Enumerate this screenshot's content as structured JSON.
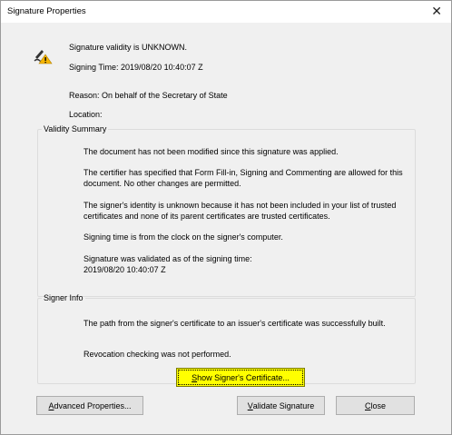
{
  "window": {
    "title": "Signature Properties",
    "close_glyph": "✕"
  },
  "signature": {
    "icon": "signature-warning-icon",
    "validity": "Signature validity is UNKNOWN.",
    "signing_time": "Signing Time:  2019/08/20 10:40:07 Z",
    "reason": "Reason:  On behalf of the Secretary of State",
    "location": "Location:"
  },
  "validity_summary": {
    "legend": "Validity Summary",
    "items": [
      "The document has not been modified since this signature was applied.",
      "The certifier has specified that Form Fill-in, Signing and Commenting are allowed for this document. No other changes are permitted.",
      "The signer's identity is unknown because it has not been included in your list of trusted certificates and none of its parent certificates are trusted certificates.",
      "Signing time is from the clock on the signer's computer.",
      "Signature was validated as of the signing time:"
    ],
    "validated_time": "2019/08/20 10:40:07 Z"
  },
  "signer_info": {
    "legend": "Signer Info",
    "items": [
      "The path from the signer's certificate to an issuer's certificate was successfully built.",
      "Revocation checking was not performed."
    ]
  },
  "buttons": {
    "show_cert": {
      "mnemonic": "S",
      "rest": "how Signer's Certificate..."
    },
    "advanced": {
      "mnemonic": "A",
      "rest": "dvanced Properties..."
    },
    "validate": {
      "mnemonic": "V",
      "rest": "alidate Signature"
    },
    "close": {
      "mnemonic": "C",
      "rest": "lose"
    }
  },
  "colors": {
    "highlight": "#ffff00",
    "dialog_bg": "#f0f0f0",
    "warning": "#f5b400"
  }
}
